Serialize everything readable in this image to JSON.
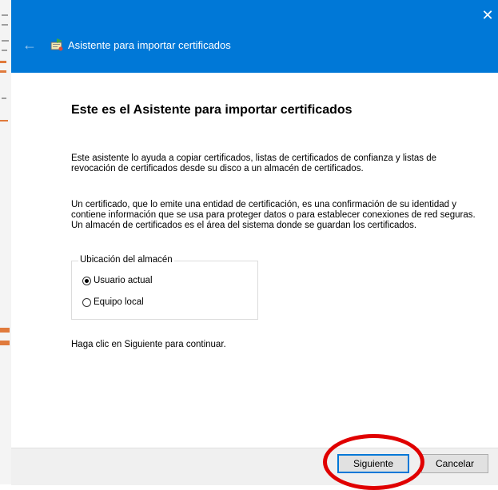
{
  "window": {
    "title": "Asistente para importar certificados"
  },
  "heading": "Este es el Asistente para importar certificados",
  "paragraph1": "Este asistente lo ayuda a copiar certificados, listas de certificados de confianza y listas de revocación de certificados desde su disco a un almacén de certificados.",
  "paragraph2": "Un certificado, que lo emite una entidad de certificación, es una confirmación de su identidad y contiene información que se usa para proteger datos o para establecer conexiones de red seguras. Un almacén de certificados es el área del sistema donde se guardan los certificados.",
  "store_location": {
    "legend": "Ubicación del almacén",
    "options": [
      {
        "label": "Usuario actual",
        "selected": true
      },
      {
        "label": "Equipo local",
        "selected": false
      }
    ]
  },
  "instruction": "Haga clic en Siguiente para continuar.",
  "buttons": {
    "next": "Siguiente",
    "cancel": "Cancelar"
  },
  "colors": {
    "titlebar": "#0078d7",
    "annotation": "#e00000"
  }
}
